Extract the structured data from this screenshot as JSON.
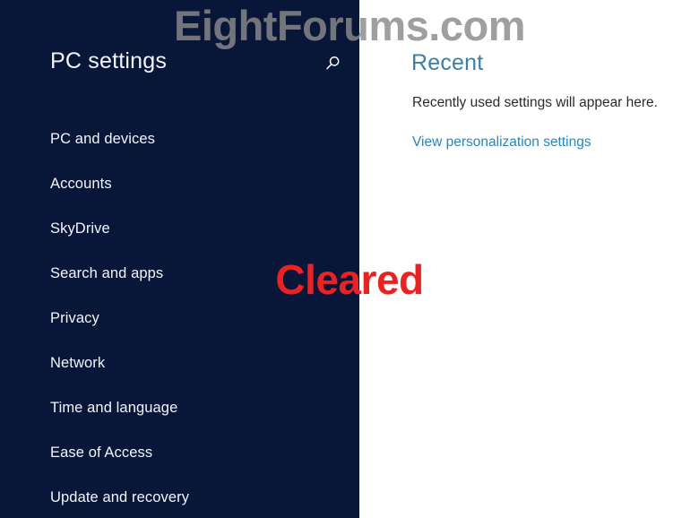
{
  "app": {
    "title": "PC settings",
    "background_color": "#08163a",
    "content_background_color": "#ffffff"
  },
  "header": {
    "title": "PC settings",
    "search_icon": "search-icon"
  },
  "sidebar": {
    "items": [
      {
        "label": "PC and devices"
      },
      {
        "label": "Accounts"
      },
      {
        "label": "SkyDrive"
      },
      {
        "label": "Search and apps"
      },
      {
        "label": "Privacy"
      },
      {
        "label": "Network"
      },
      {
        "label": "Time and language"
      },
      {
        "label": "Ease of Access"
      },
      {
        "label": "Update and recovery"
      }
    ]
  },
  "content": {
    "heading": "Recent",
    "heading_color": "#3a7fa8",
    "empty_message": "Recently used settings will appear here.",
    "link_label": "View personalization settings",
    "link_color": "#2786bd"
  },
  "overlays": {
    "watermark_text": "EightForums.com",
    "watermark_color": "#8a8a8a",
    "annotation_text": "Cleared",
    "annotation_color": "#ee2120"
  }
}
